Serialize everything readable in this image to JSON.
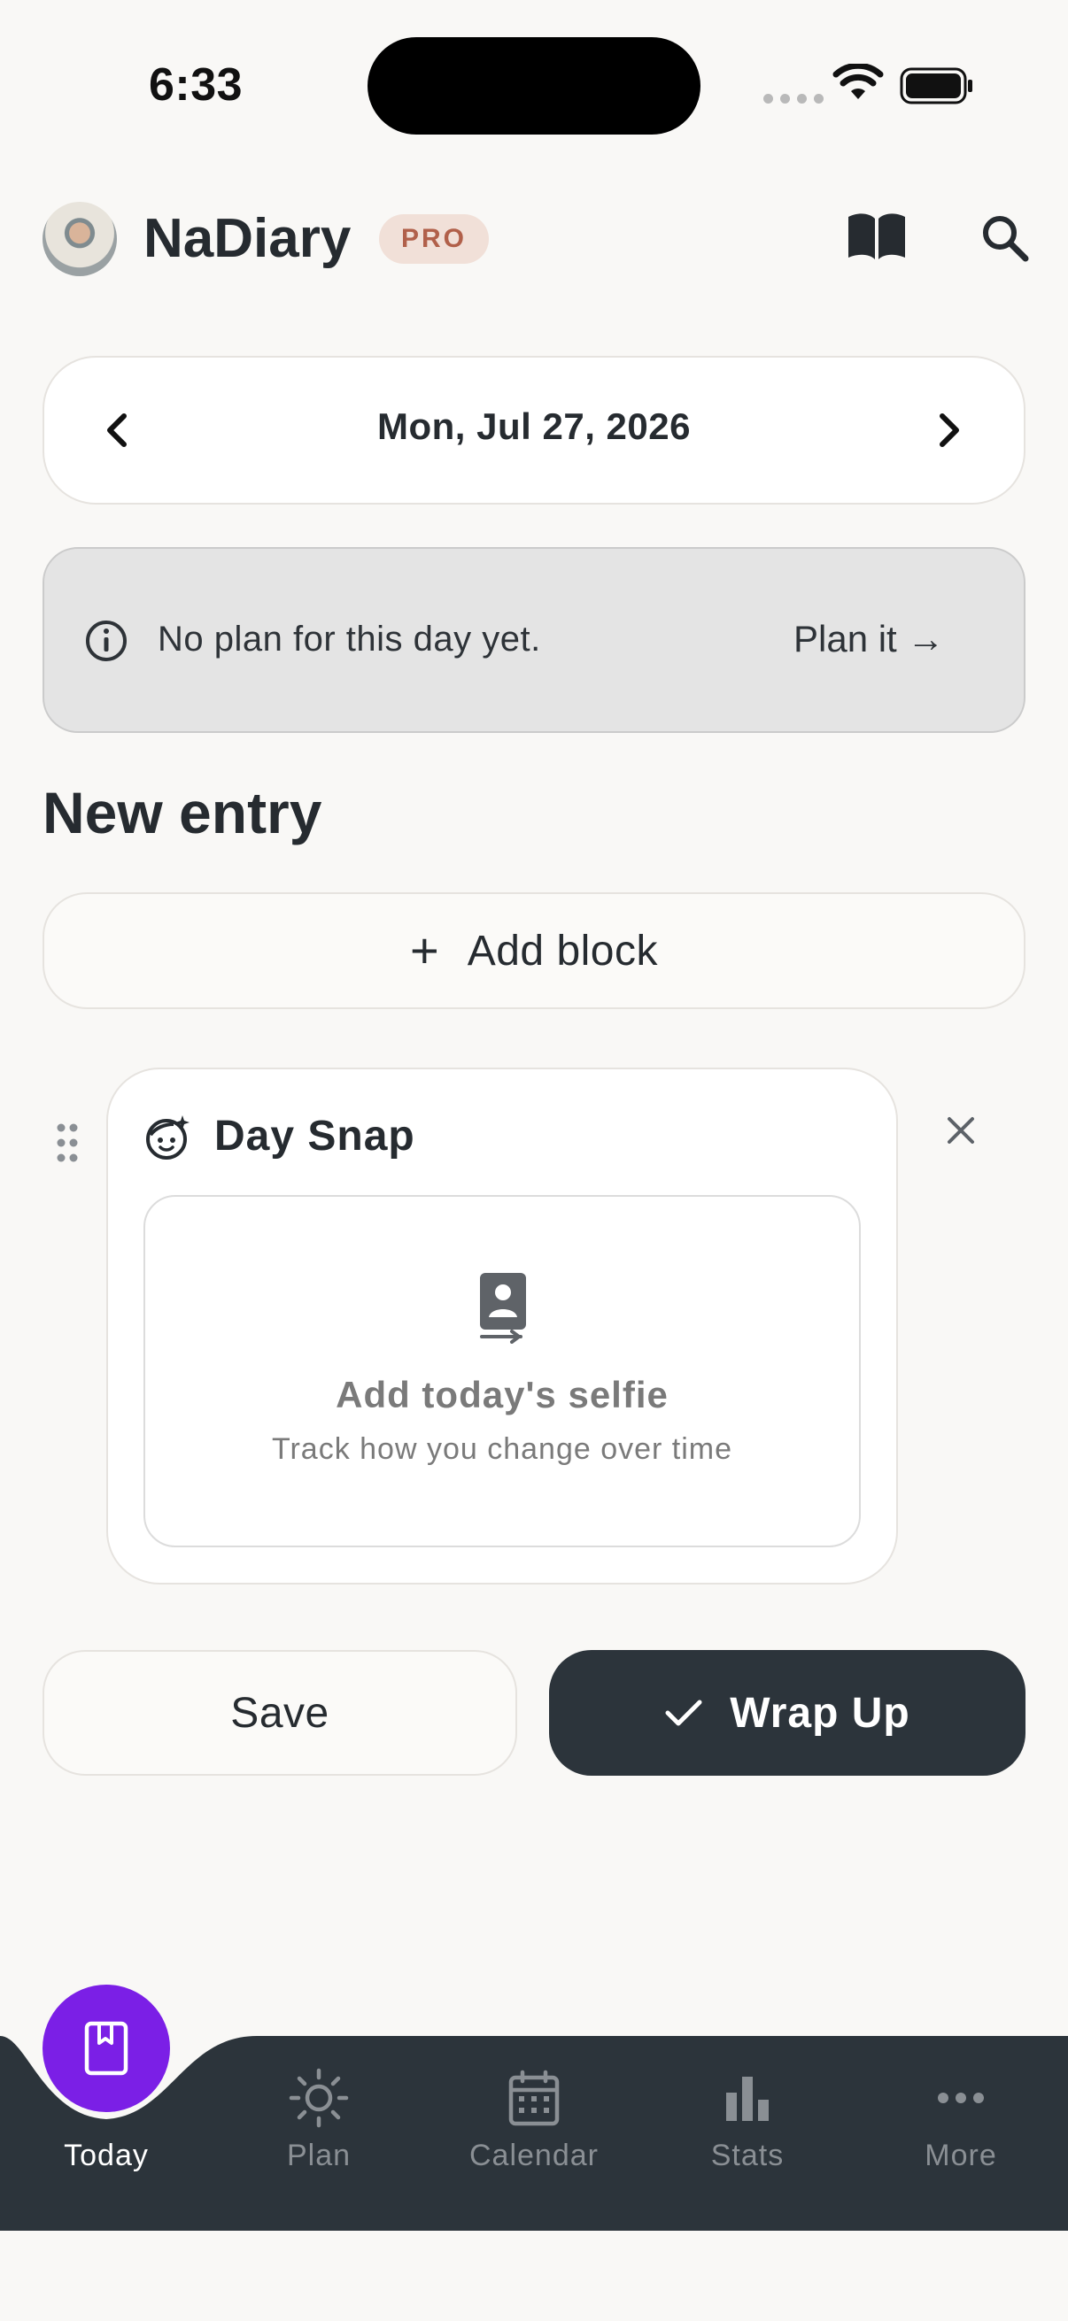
{
  "status_bar": {
    "time": "6:33"
  },
  "header": {
    "app_name": "NaDiary",
    "badge": "PRO"
  },
  "date_nav": {
    "date": "Mon, Jul 27, 2026"
  },
  "plan_banner": {
    "message": "No plan for this day yet.",
    "action": "Plan it →"
  },
  "entry": {
    "section_title": "New entry",
    "add_block_label": "Add block",
    "day_snap": {
      "title": "Day Snap",
      "selfie_title": "Add today's selfie",
      "selfie_subtitle": "Track how you change over time"
    }
  },
  "actions": {
    "save": "Save",
    "wrap_up": "Wrap Up"
  },
  "tabbar": {
    "items": [
      {
        "label": "Today",
        "icon": "diary-icon",
        "active": true
      },
      {
        "label": "Plan",
        "icon": "sun-icon",
        "active": false
      },
      {
        "label": "Calendar",
        "icon": "calendar-icon",
        "active": false
      },
      {
        "label": "Stats",
        "icon": "bar-chart-icon",
        "active": false
      },
      {
        "label": "More",
        "icon": "more-dots-icon",
        "active": false
      }
    ]
  },
  "colors": {
    "background": "#f9f8f6",
    "accent": "#7b1fe6",
    "dark": "#2c343b",
    "pro_badge_bg": "#f1e0d8",
    "pro_badge_text": "#b1604a"
  }
}
